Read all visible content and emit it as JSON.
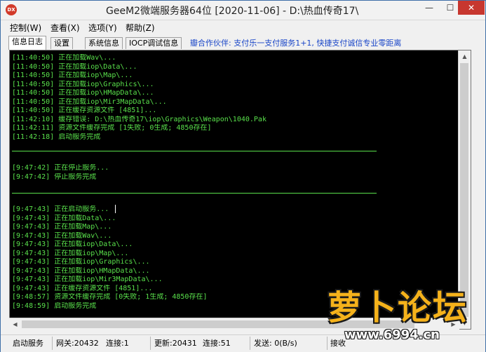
{
  "window": {
    "title": "GeeM2微端服务器64位 [2020-11-06] - D:\\热血传奇17\\",
    "icon_label": "DX",
    "min_glyph": "—",
    "max_glyph": "☐",
    "close_glyph": "✕"
  },
  "menu": [
    "控制(W)",
    "查看(X)",
    "选项(Y)",
    "帮助(Z)"
  ],
  "tabs": [
    {
      "label": "信息日志",
      "active": true
    },
    {
      "label": "设置",
      "active": false
    },
    {
      "label": "系统信息",
      "active": false
    },
    {
      "label": "IOCP调试信息",
      "active": false
    }
  ],
  "partner_text": "瓣合作伙伴: 支付乐一支付服务1+1, 快捷支付诚信专业零距离",
  "log": {
    "block1": [
      "[11:40:50] 正在加载Wav\\...",
      "[11:40:50] 正在加载iop\\Data\\...",
      "[11:40:50] 正在加载iop\\Map\\...",
      "[11:40:50] 正在加载iop\\Graphics\\...",
      "[11:40:50] 正在加载iop\\HMapData\\...",
      "[11:40:50] 正在加载iop\\Mir3MapData\\...",
      "[11:40:50] 正在缓存资源文件 [4851]...",
      "[11:42:10] 缓存错误: D:\\热血传奇17\\iop\\Graphics\\Weapon\\1040.Pak",
      "[11:42:11] 资源文件缓存完成 [1失败; 0生成; 4850存在]",
      "[11:42:18] 启动服务完成"
    ],
    "block2": [
      "[9:47:42] 正在停止服务...",
      "[9:47:42] 停止服务完成"
    ],
    "block3": [
      "[9:47:43] 正在启动服务...",
      "[9:47:43] 正在加载Data\\...",
      "[9:47:43] 正在加载Map\\...",
      "[9:47:43] 正在加载Wav\\...",
      "[9:47:43] 正在加载iop\\Data\\...",
      "[9:47:43] 正在加载iop\\Map\\...",
      "[9:47:43] 正在加载iop\\Graphics\\...",
      "[9:47:43] 正在加载iop\\HMapData\\...",
      "[9:47:43] 正在加载iop\\Mir3MapData\\...",
      "[9:47:43] 正在缓存资源文件 [4851]...",
      "[9:48:57] 资源文件缓存完成 [0失败; 1生成; 4850存在]",
      "[9:48:59] 启动服务完成"
    ]
  },
  "scrollbar": {
    "arrow_up": "▲",
    "arrow_down": "▼",
    "arrow_left": "◀",
    "arrow_right": "▶"
  },
  "status": {
    "service": "启动服务",
    "gateway": "网关:20432",
    "gateway_conn": "连接:1",
    "update": "更新:20431",
    "update_conn": "连接:51",
    "send": "发送: 0(B/s)",
    "receive": "接收"
  },
  "watermark": {
    "main": "萝卜论坛",
    "url": "www.6994.cn"
  }
}
